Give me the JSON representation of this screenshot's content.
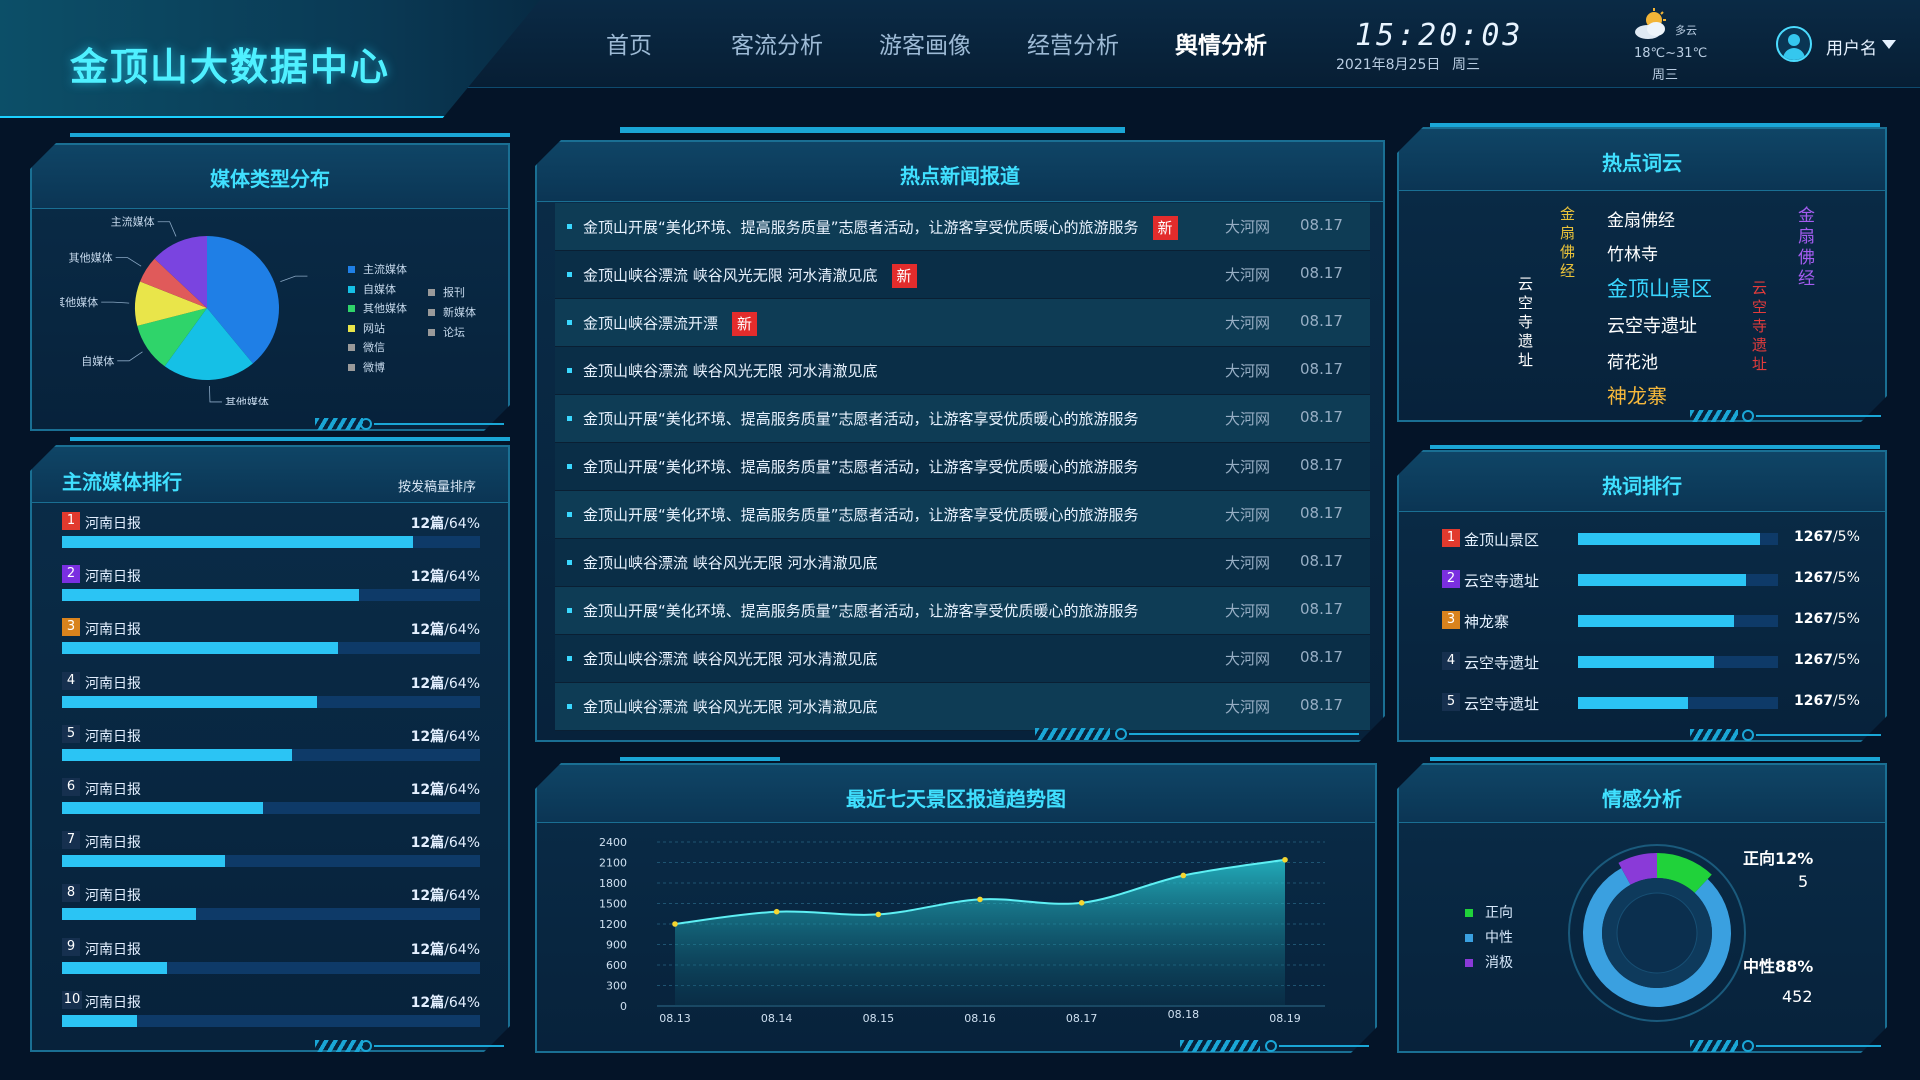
{
  "header": {
    "title": "金顶山大数据中心",
    "nav": [
      "首页",
      "客流分析",
      "游客画像",
      "经营分析",
      "舆情分析"
    ],
    "active_nav": "舆情分析",
    "time": "15:20:03",
    "date": "2021年8月25日",
    "weekday": "周三",
    "weather": {
      "icon": "partly-cloudy-icon",
      "condition": "多云",
      "temp": "18℃~31℃",
      "weekday": "周三"
    },
    "user": {
      "name": "用户名"
    }
  },
  "media_type": {
    "title": "媒体类型分布",
    "slice_labels": [
      "主流媒体",
      "其他媒体",
      "自媒体",
      "其他媒体",
      "其他媒体",
      "主流媒体"
    ],
    "legend_left": [
      "主流媒体",
      "自媒体",
      "其他媒体",
      "网站",
      "微信",
      "微博"
    ],
    "legend_right": [
      "报刊",
      "新媒体",
      "论坛"
    ],
    "colors": [
      "#1f7fe6",
      "#15c0e6",
      "#2fd46a",
      "#e9e54a",
      "#e05a5a",
      "#7a44e0"
    ]
  },
  "media_rank": {
    "title": "主流媒体排行",
    "sort_label": "按发稿量排序",
    "rows": [
      {
        "rank": "1",
        "name": "河南日报",
        "count": "12篇",
        "pct": "/64%",
        "level": 0.84
      },
      {
        "rank": "2",
        "name": "河南日报",
        "count": "12篇",
        "pct": "/64%",
        "level": 0.71
      },
      {
        "rank": "3",
        "name": "河南日报",
        "count": "12篇",
        "pct": "/64%",
        "level": 0.66
      },
      {
        "rank": "4",
        "name": "河南日报",
        "count": "12篇",
        "pct": "/64%",
        "level": 0.61
      },
      {
        "rank": "5",
        "name": "河南日报",
        "count": "12篇",
        "pct": "/64%",
        "level": 0.55
      },
      {
        "rank": "6",
        "name": "河南日报",
        "count": "12篇",
        "pct": "/64%",
        "level": 0.48
      },
      {
        "rank": "7",
        "name": "河南日报",
        "count": "12篇",
        "pct": "/64%",
        "level": 0.39
      },
      {
        "rank": "8",
        "name": "河南日报",
        "count": "12篇",
        "pct": "/64%",
        "level": 0.32
      },
      {
        "rank": "9",
        "name": "河南日报",
        "count": "12篇",
        "pct": "/64%",
        "level": 0.25
      },
      {
        "rank": "10",
        "name": "河南日报",
        "count": "12篇",
        "pct": "/64%",
        "level": 0.18
      }
    ],
    "badge_colors": [
      "#e23a2e",
      "#7a2fe0",
      "#d9831d",
      "#16304f"
    ]
  },
  "news": {
    "title": "热点新闻报道",
    "new_label": "新",
    "items": [
      {
        "title": "金顶山开展“美化环境、提高服务质量”志愿者活动，让游客享受优质暖心的旅游服务",
        "is_new": true,
        "source": "大河网",
        "date": "08.17"
      },
      {
        "title": "金顶山峡谷漂流 峡谷风光无限 河水清澈见底",
        "is_new": true,
        "source": "大河网",
        "date": "08.17"
      },
      {
        "title": "金顶山峡谷漂流开漂",
        "is_new": true,
        "source": "大河网",
        "date": "08.17"
      },
      {
        "title": "金顶山峡谷漂流 峡谷风光无限 河水清澈见底",
        "is_new": false,
        "source": "大河网",
        "date": "08.17"
      },
      {
        "title": "金顶山开展“美化环境、提高服务质量”志愿者活动，让游客享受优质暖心的旅游服务",
        "is_new": false,
        "source": "大河网",
        "date": "08.17"
      },
      {
        "title": "金顶山开展“美化环境、提高服务质量”志愿者活动，让游客享受优质暖心的旅游服务",
        "is_new": false,
        "source": "大河网",
        "date": "08.17"
      },
      {
        "title": "金顶山开展“美化环境、提高服务质量”志愿者活动，让游客享受优质暖心的旅游服务",
        "is_new": false,
        "source": "大河网",
        "date": "08.17"
      },
      {
        "title": "金顶山峡谷漂流 峡谷风光无限 河水清澈见底",
        "is_new": false,
        "source": "大河网",
        "date": "08.17"
      },
      {
        "title": "金顶山开展“美化环境、提高服务质量”志愿者活动，让游客享受优质暖心的旅游服务",
        "is_new": false,
        "source": "大河网",
        "date": "08.17"
      },
      {
        "title": "金顶山峡谷漂流 峡谷风光无限 河水清澈见底",
        "is_new": false,
        "source": "大河网",
        "date": "08.17"
      },
      {
        "title": "金顶山峡谷漂流 峡谷风光无限 河水清澈见底",
        "is_new": false,
        "source": "大河网",
        "date": "08.17"
      }
    ]
  },
  "trend": {
    "title": "最近七天景区报道趋势图"
  },
  "word_cloud": {
    "title": "热点词云",
    "horizontal": [
      {
        "text": "金扇佛经",
        "color": "#ffffff"
      },
      {
        "text": "竹林寺",
        "color": "#ffffff"
      },
      {
        "text": "金顶山景区",
        "color": "#39d6ff"
      },
      {
        "text": "云空寺遗址",
        "color": "#ffffff"
      },
      {
        "text": "荷花池",
        "color": "#ffffff"
      },
      {
        "text": "神龙寨",
        "color": "#f5b73b"
      }
    ],
    "vertical": [
      {
        "text": "云空寺遗址",
        "color": "#ffffff"
      },
      {
        "text": "金扇佛经",
        "color": "#e9c23a"
      },
      {
        "text": "云空寺遗址",
        "color": "#e33b3b"
      },
      {
        "text": "金扇佛经",
        "color": "#a45cf0"
      }
    ]
  },
  "hot_words": {
    "title": "热词排行",
    "rows": [
      {
        "rank": "1",
        "name": "金顶山景区",
        "value": "1267",
        "pct": "/5%",
        "level": 0.91
      },
      {
        "rank": "2",
        "name": "云空寺遗址",
        "value": "1267",
        "pct": "/5%",
        "level": 0.84
      },
      {
        "rank": "3",
        "name": "神龙寨",
        "value": "1267",
        "pct": "/5%",
        "level": 0.78
      },
      {
        "rank": "4",
        "name": "云空寺遗址",
        "value": "1267",
        "pct": "/5%",
        "level": 0.68
      },
      {
        "rank": "5",
        "name": "云空寺遗址",
        "value": "1267",
        "pct": "/5%",
        "level": 0.55
      }
    ]
  },
  "sentiment": {
    "title": "情感分析",
    "legend": [
      {
        "label": "正向",
        "color": "#20d23a"
      },
      {
        "label": "中性",
        "color": "#3aa0e0"
      },
      {
        "label": "消极",
        "color": "#8a3ad8"
      }
    ],
    "positive_label": "正向12%",
    "positive_count": "5",
    "neutral_label": "中性88%",
    "neutral_count": "452"
  },
  "chart_data": [
    {
      "type": "pie",
      "title": "媒体类型分布",
      "labels": [
        "主流媒体",
        "其他媒体",
        "自媒体",
        "其他媒体",
        "其他媒体",
        "主流媒体"
      ],
      "values": [
        39,
        21,
        11,
        10,
        6,
        13
      ]
    },
    {
      "type": "area",
      "title": "最近七天景区报道趋势图",
      "x": [
        "08.13",
        "08.14",
        "08.15",
        "08.16",
        "08.17",
        "08.18",
        "08.19"
      ],
      "series": [
        {
          "values": [
            1200,
            1380,
            1340,
            1560,
            1510,
            1910,
            2140
          ]
        }
      ],
      "yticks": [
        "0",
        "300",
        "600",
        "900",
        "1200",
        "1500",
        "1800",
        "2100",
        "2400"
      ],
      "ylim": [
        0,
        2400
      ],
      "grid": true
    },
    {
      "type": "pie",
      "title": "情感分析",
      "labels": [
        "正向",
        "中性",
        "消极"
      ],
      "values": [
        12,
        80,
        8
      ]
    }
  ]
}
